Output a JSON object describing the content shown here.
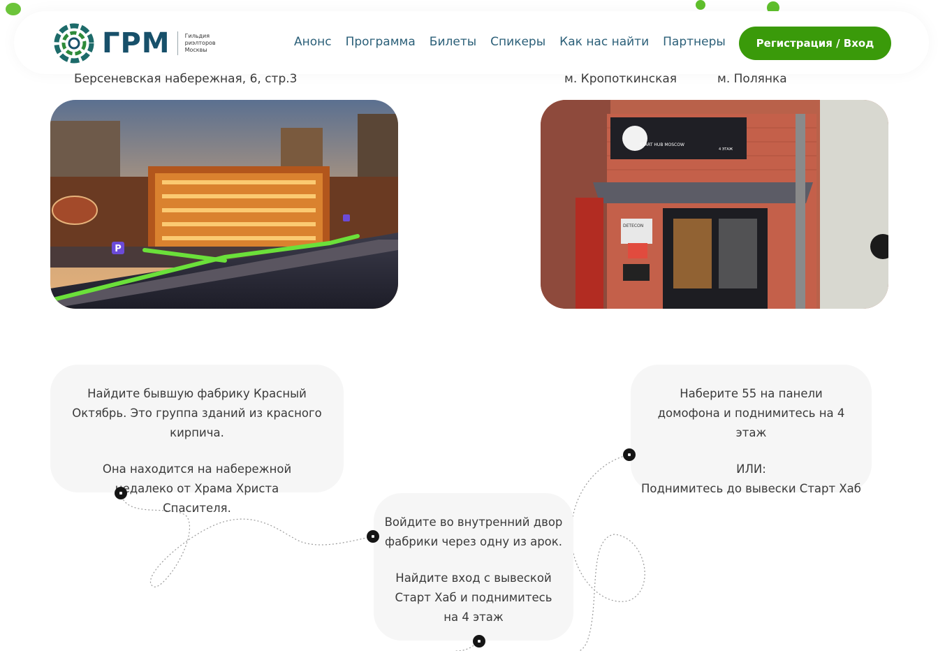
{
  "header": {
    "logo_text": "ГРМ",
    "logo_sub": [
      "Гильдия",
      "риэлторов",
      "Москвы"
    ],
    "nav": [
      "Анонс",
      "Программа",
      "Билеты",
      "Спикеры",
      "Как нас найти",
      "Партнеры"
    ],
    "register_label": "Регистрация / Вход"
  },
  "locations": {
    "left_address": "Берсеневская набережная, 6, стр.3",
    "metro": [
      "м. Кропоткинская",
      "м. Полянка"
    ]
  },
  "steps": {
    "step1": {
      "p1": "Найдите бывшую фабрику Красный Октябрь. Это группа зданий из красного кирпича.",
      "p2": "Она находится на набережной недалеко от Храма Христа Спасителя."
    },
    "step2": {
      "p1": "Войдите во внутренний двор фабрики через одну из арок.",
      "p2": "Найдите вход с вывеской Старт Хаб и поднимитесь на 4 этаж"
    },
    "step3": {
      "p1": "Наберите 55 на панели домофона и поднимитесь на 4 этаж",
      "p2": "ИЛИ:",
      "p3": "Поднимитесь до вывески Старт Хаб"
    }
  },
  "sign": {
    "title": "START HUB MOSCOW",
    "floor": "4 ЭТАЖ",
    "detecon": "DETECON"
  },
  "colors": {
    "accent": "#3a9a0a",
    "nav_text": "#2b5f78",
    "logo": "#17506a",
    "card_bg": "#f6f6f6"
  }
}
